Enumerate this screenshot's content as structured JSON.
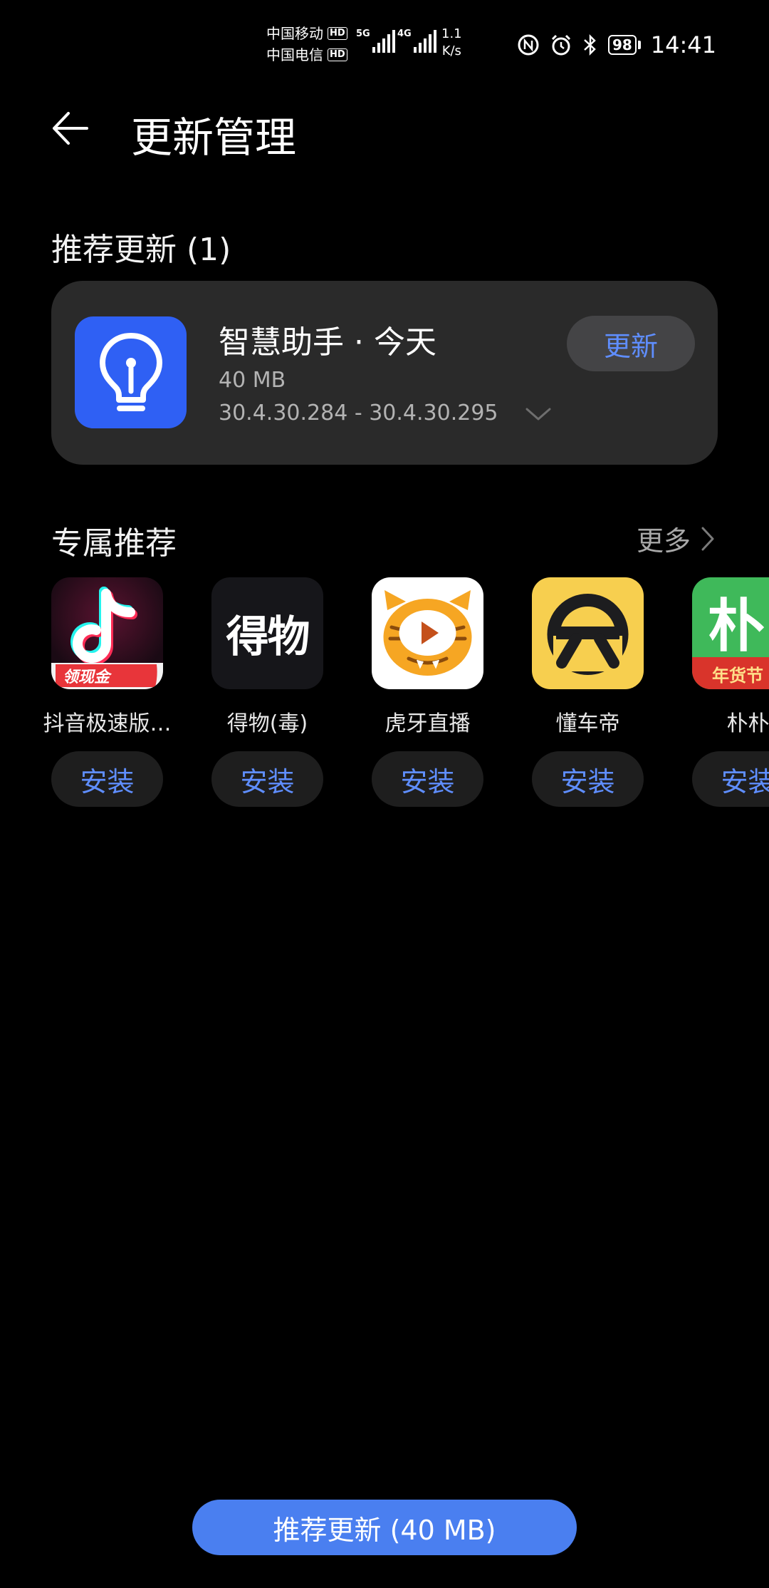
{
  "status": {
    "carrier1": "中国移动",
    "carrier2": "中国电信",
    "hd": "HD",
    "net1": "5G",
    "net2": "4G",
    "speed_value": "1.1",
    "speed_unit": "K/s",
    "battery": "98",
    "time": "14:41"
  },
  "header": {
    "title": "更新管理"
  },
  "recommended_updates": {
    "title": "推荐更新 (1)",
    "app": {
      "name": "智慧助手 · 今天",
      "size": "40 MB",
      "version": "30.4.30.284 - 30.4.30.295",
      "button": "更新",
      "icon": "lightbulb-icon",
      "icon_color": "#2f60f4"
    }
  },
  "exclusive": {
    "title": "专属推荐",
    "more": "更多",
    "apps": [
      {
        "name": "抖音极速版…",
        "button": "安装",
        "icon": "douyin-lite-icon",
        "badge": "领现金"
      },
      {
        "name": "得物(毒)",
        "button": "安装",
        "icon": "dewu-icon",
        "logo_text": "得物"
      },
      {
        "name": "虎牙直播",
        "button": "安装",
        "icon": "huya-icon"
      },
      {
        "name": "懂车帝",
        "button": "安装",
        "icon": "dongchedi-icon"
      },
      {
        "name": "朴朴",
        "button": "安装",
        "icon": "pupu-icon",
        "logo_text": "朴",
        "badge": "年货节"
      }
    ]
  },
  "bottom_button": "推荐更新 (40 MB)",
  "colors": {
    "accent": "#5f8eff",
    "primary_button": "#4a7ff0",
    "card": "#2a2a2a",
    "background": "#000000"
  }
}
